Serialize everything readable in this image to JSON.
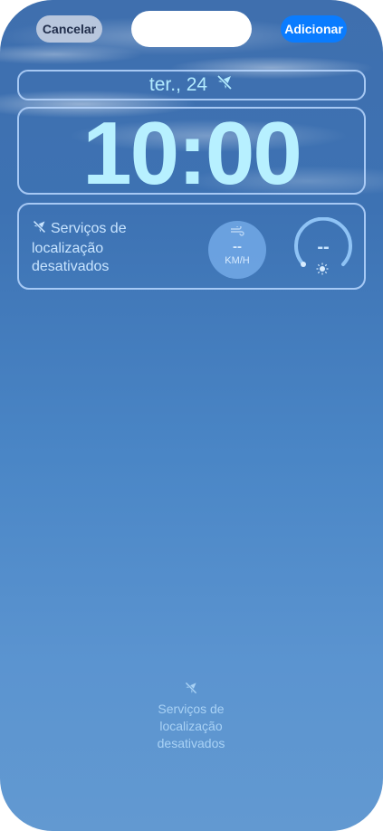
{
  "header": {
    "cancel_label": "Cancelar",
    "add_label": "Adicionar"
  },
  "lock_screen": {
    "date": "ter., 24",
    "time": "10:00"
  },
  "widgets": {
    "location": {
      "lines": [
        "Serviços de",
        "localização",
        "desativados"
      ]
    },
    "wind": {
      "value": "--",
      "unit": "KM/H"
    },
    "uv": {
      "value": "--"
    }
  },
  "bottom_widget": {
    "lines": [
      "Serviços de",
      "localização",
      "desativados"
    ]
  },
  "colors": {
    "accent": "#0a7cff",
    "clock_text": "#b7f0ff",
    "widget_border": "#b9d7ff"
  },
  "icons": {
    "date": "location-off-icon",
    "location": "location-off-icon",
    "wind": "wind-icon",
    "uv": "sun-icon"
  }
}
